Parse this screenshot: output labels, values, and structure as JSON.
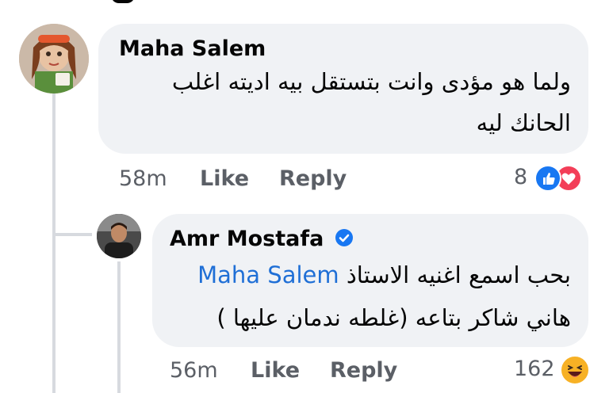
{
  "comments": [
    {
      "author": "Maha Salem",
      "lines": [
        "ولما هو مؤدى وانت بتستقل بيه اديته اغلب",
        "الحانك ليه"
      ],
      "time": "58m",
      "like_label": "Like",
      "reply_label": "Reply",
      "reaction_count": "8",
      "reactions": [
        "like-icon",
        "love-icon"
      ]
    },
    {
      "author": "Amr Mostafa",
      "verified": true,
      "mention": "Maha Salem",
      "line1_text": "بحب اسمع اغنيه الاستاذ",
      "line2": "هاني شاكر بتاعه (غلطه ندمان عليها )",
      "time": "56m",
      "like_label": "Like",
      "reply_label": "Reply",
      "reaction_count": "162",
      "reactions": [
        "haha-icon"
      ]
    }
  ],
  "colors": {
    "bubble": "#f0f2f5",
    "link": "#1f6fd6",
    "like_blue": "#1877f2",
    "love_red": "#f33e58",
    "haha_yellow": "#f7b125"
  }
}
